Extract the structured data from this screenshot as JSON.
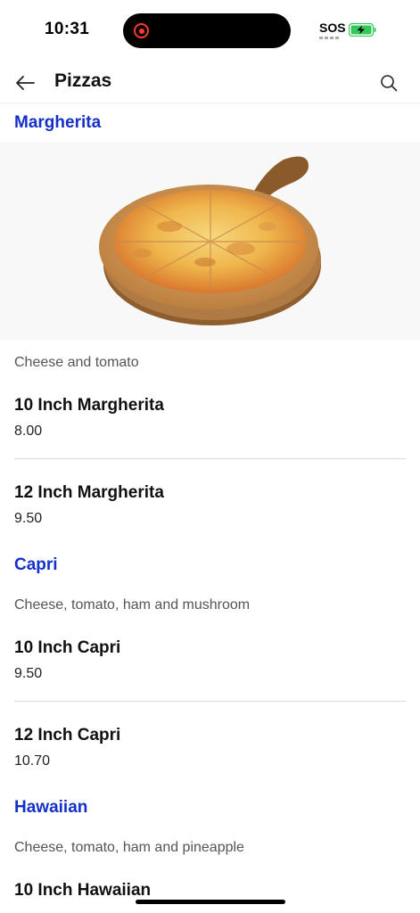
{
  "status_bar": {
    "time": "10:31",
    "sos": "SOS",
    "recording_color": "#ff3b30",
    "battery_color": "#34c759"
  },
  "app_bar": {
    "title": "Pizzas",
    "back_icon": "arrow-left-icon",
    "search_icon": "search-icon"
  },
  "colors": {
    "accent": "#1530c9",
    "divider": "#d9d9d9"
  },
  "sections": [
    {
      "title": "Margherita",
      "description": "Cheese and tomato",
      "items": [
        {
          "name": "10 Inch Margherita",
          "price": "8.00"
        },
        {
          "name": "12 Inch Margherita",
          "price": "9.50"
        }
      ]
    },
    {
      "title": "Capri",
      "description": "Cheese, tomato, ham and mushroom",
      "items": [
        {
          "name": "10 Inch Capri",
          "price": "9.50"
        },
        {
          "name": "12 Inch Capri",
          "price": "10.70"
        }
      ]
    },
    {
      "title": "Hawaiian",
      "description": "Cheese, tomato, ham and pineapple",
      "items": [
        {
          "name": "10 Inch Hawaiian",
          "price": ""
        }
      ]
    }
  ]
}
